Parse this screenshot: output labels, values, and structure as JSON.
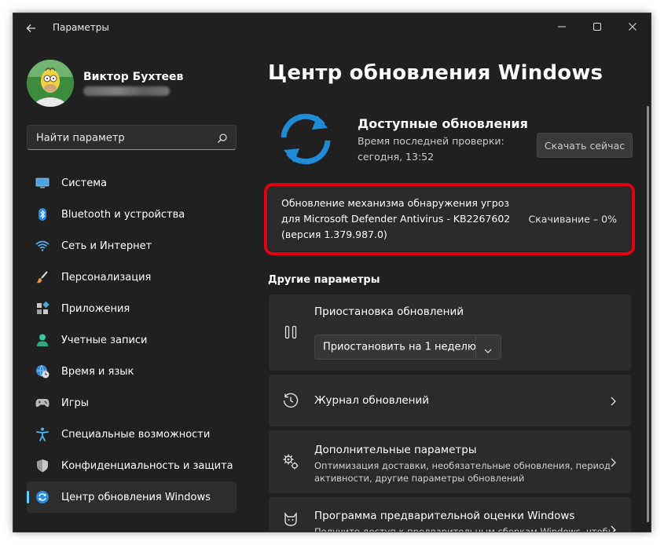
{
  "window": {
    "title": "Параметры"
  },
  "profile": {
    "name": "Виктор Бухтеев"
  },
  "search": {
    "placeholder": "Найти параметр"
  },
  "sidebar": {
    "items": [
      {
        "label": "Система",
        "icon": "monitor-icon"
      },
      {
        "label": "Bluetooth и устройства",
        "icon": "bluetooth-icon"
      },
      {
        "label": "Сеть и Интернет",
        "icon": "wifi-icon"
      },
      {
        "label": "Персонализация",
        "icon": "brush-icon"
      },
      {
        "label": "Приложения",
        "icon": "apps-icon"
      },
      {
        "label": "Учетные записи",
        "icon": "person-icon"
      },
      {
        "label": "Время и язык",
        "icon": "globe-clock-icon"
      },
      {
        "label": "Игры",
        "icon": "gamepad-icon"
      },
      {
        "label": "Специальные возможности",
        "icon": "accessibility-icon"
      },
      {
        "label": "Конфиденциальность и защита",
        "icon": "shield-icon"
      },
      {
        "label": "Центр обновления Windows",
        "icon": "windows-update-icon",
        "selected": true
      }
    ]
  },
  "main": {
    "title": "Центр обновления Windows",
    "status": {
      "title": "Доступные обновления",
      "last_check_label": "Время последней проверки:",
      "last_check_value": "сегодня, 13:52",
      "check_button": "Скачать сейчас"
    },
    "update_item": {
      "line1": "Обновление механизма обнаружения угроз",
      "line2": "для Microsoft Defender Antivirus - KB2267602",
      "line3": "(версия 1.379.987.0)",
      "status": "Скачивание – 0%"
    },
    "other_title": "Другие параметры",
    "pause": {
      "title": "Приостановка обновлений",
      "dropdown_value": "Приостановить на 1 неделю"
    },
    "history": {
      "title": "Журнал обновлений"
    },
    "advanced": {
      "title": "Дополнительные параметры",
      "desc1": "Оптимизация доставки, необязательные обновления, период",
      "desc2": "активности, другие параметры обновлений"
    },
    "insider": {
      "title": "Программа предварительной оценки Windows",
      "desc1": "Получите доступ к предварительным сборкам Windows, чтобы"
    }
  },
  "colors": {
    "background": "#202020",
    "card": "#2b2b2b",
    "accent": "#60cdff",
    "highlight_outline": "#e00012",
    "sync_icon": "#1f8ad6"
  }
}
